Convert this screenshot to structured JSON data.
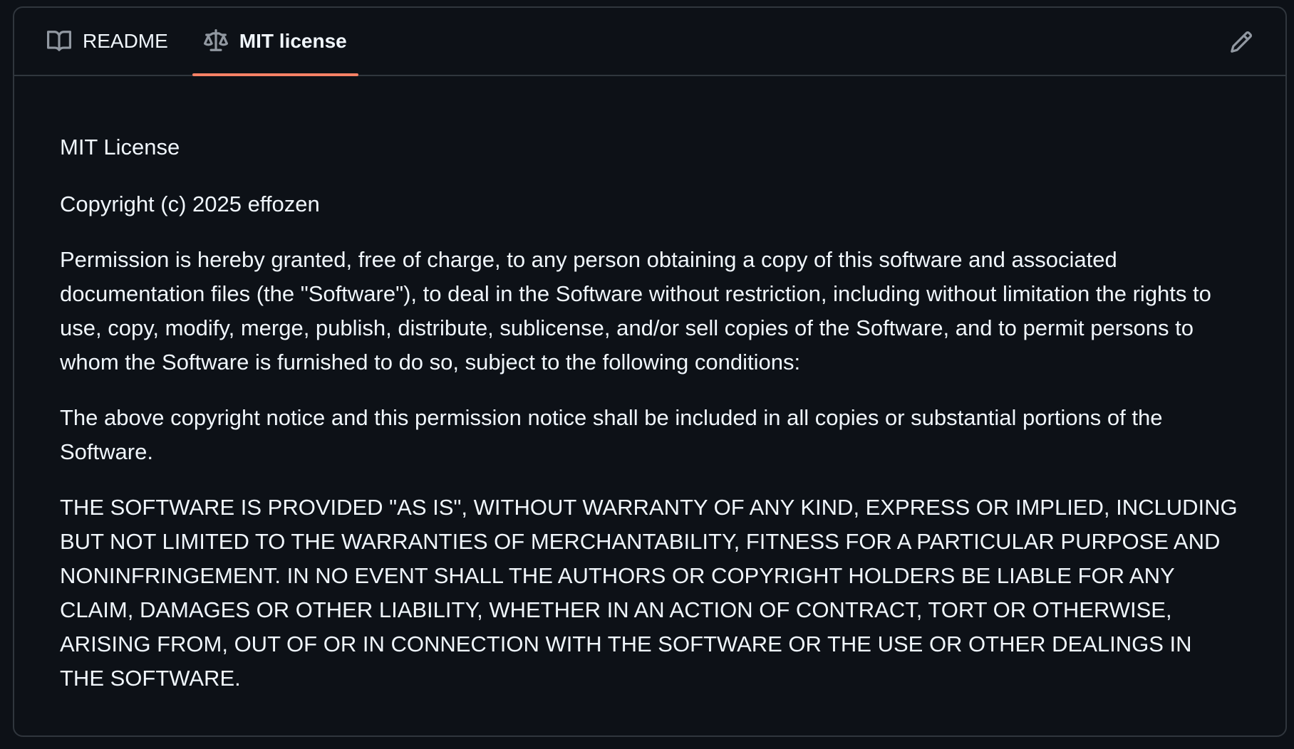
{
  "tabs": [
    {
      "label": "README",
      "icon": "book-icon",
      "active": false
    },
    {
      "label": "MIT license",
      "icon": "law-icon",
      "active": true
    }
  ],
  "edit_icon": "pencil-icon",
  "accent_color": "#f78166",
  "license": {
    "title": "MIT License",
    "copyright": "Copyright (c) 2025 effozen",
    "paragraph_permission": "Permission is hereby granted, free of charge, to any person obtaining a copy of this software and associated documentation files (the \"Software\"), to deal in the Software without restriction, including without limitation the rights to use, copy, modify, merge, publish, distribute, sublicense, and/or sell copies of the Software, and to permit persons to whom the Software is furnished to do so, subject to the following conditions:",
    "paragraph_notice": "The above copyright notice and this permission notice shall be included in all copies or substantial portions of the Software.",
    "paragraph_warranty": "THE SOFTWARE IS PROVIDED \"AS IS\", WITHOUT WARRANTY OF ANY KIND, EXPRESS OR IMPLIED, INCLUDING BUT NOT LIMITED TO THE WARRANTIES OF MERCHANTABILITY, FITNESS FOR A PARTICULAR PURPOSE AND NONINFRINGEMENT. IN NO EVENT SHALL THE AUTHORS OR COPYRIGHT HOLDERS BE LIABLE FOR ANY CLAIM, DAMAGES OR OTHER LIABILITY, WHETHER IN AN ACTION OF CONTRACT, TORT OR OTHERWISE, ARISING FROM, OUT OF OR IN CONNECTION WITH THE SOFTWARE OR THE USE OR OTHER DEALINGS IN THE SOFTWARE."
  }
}
